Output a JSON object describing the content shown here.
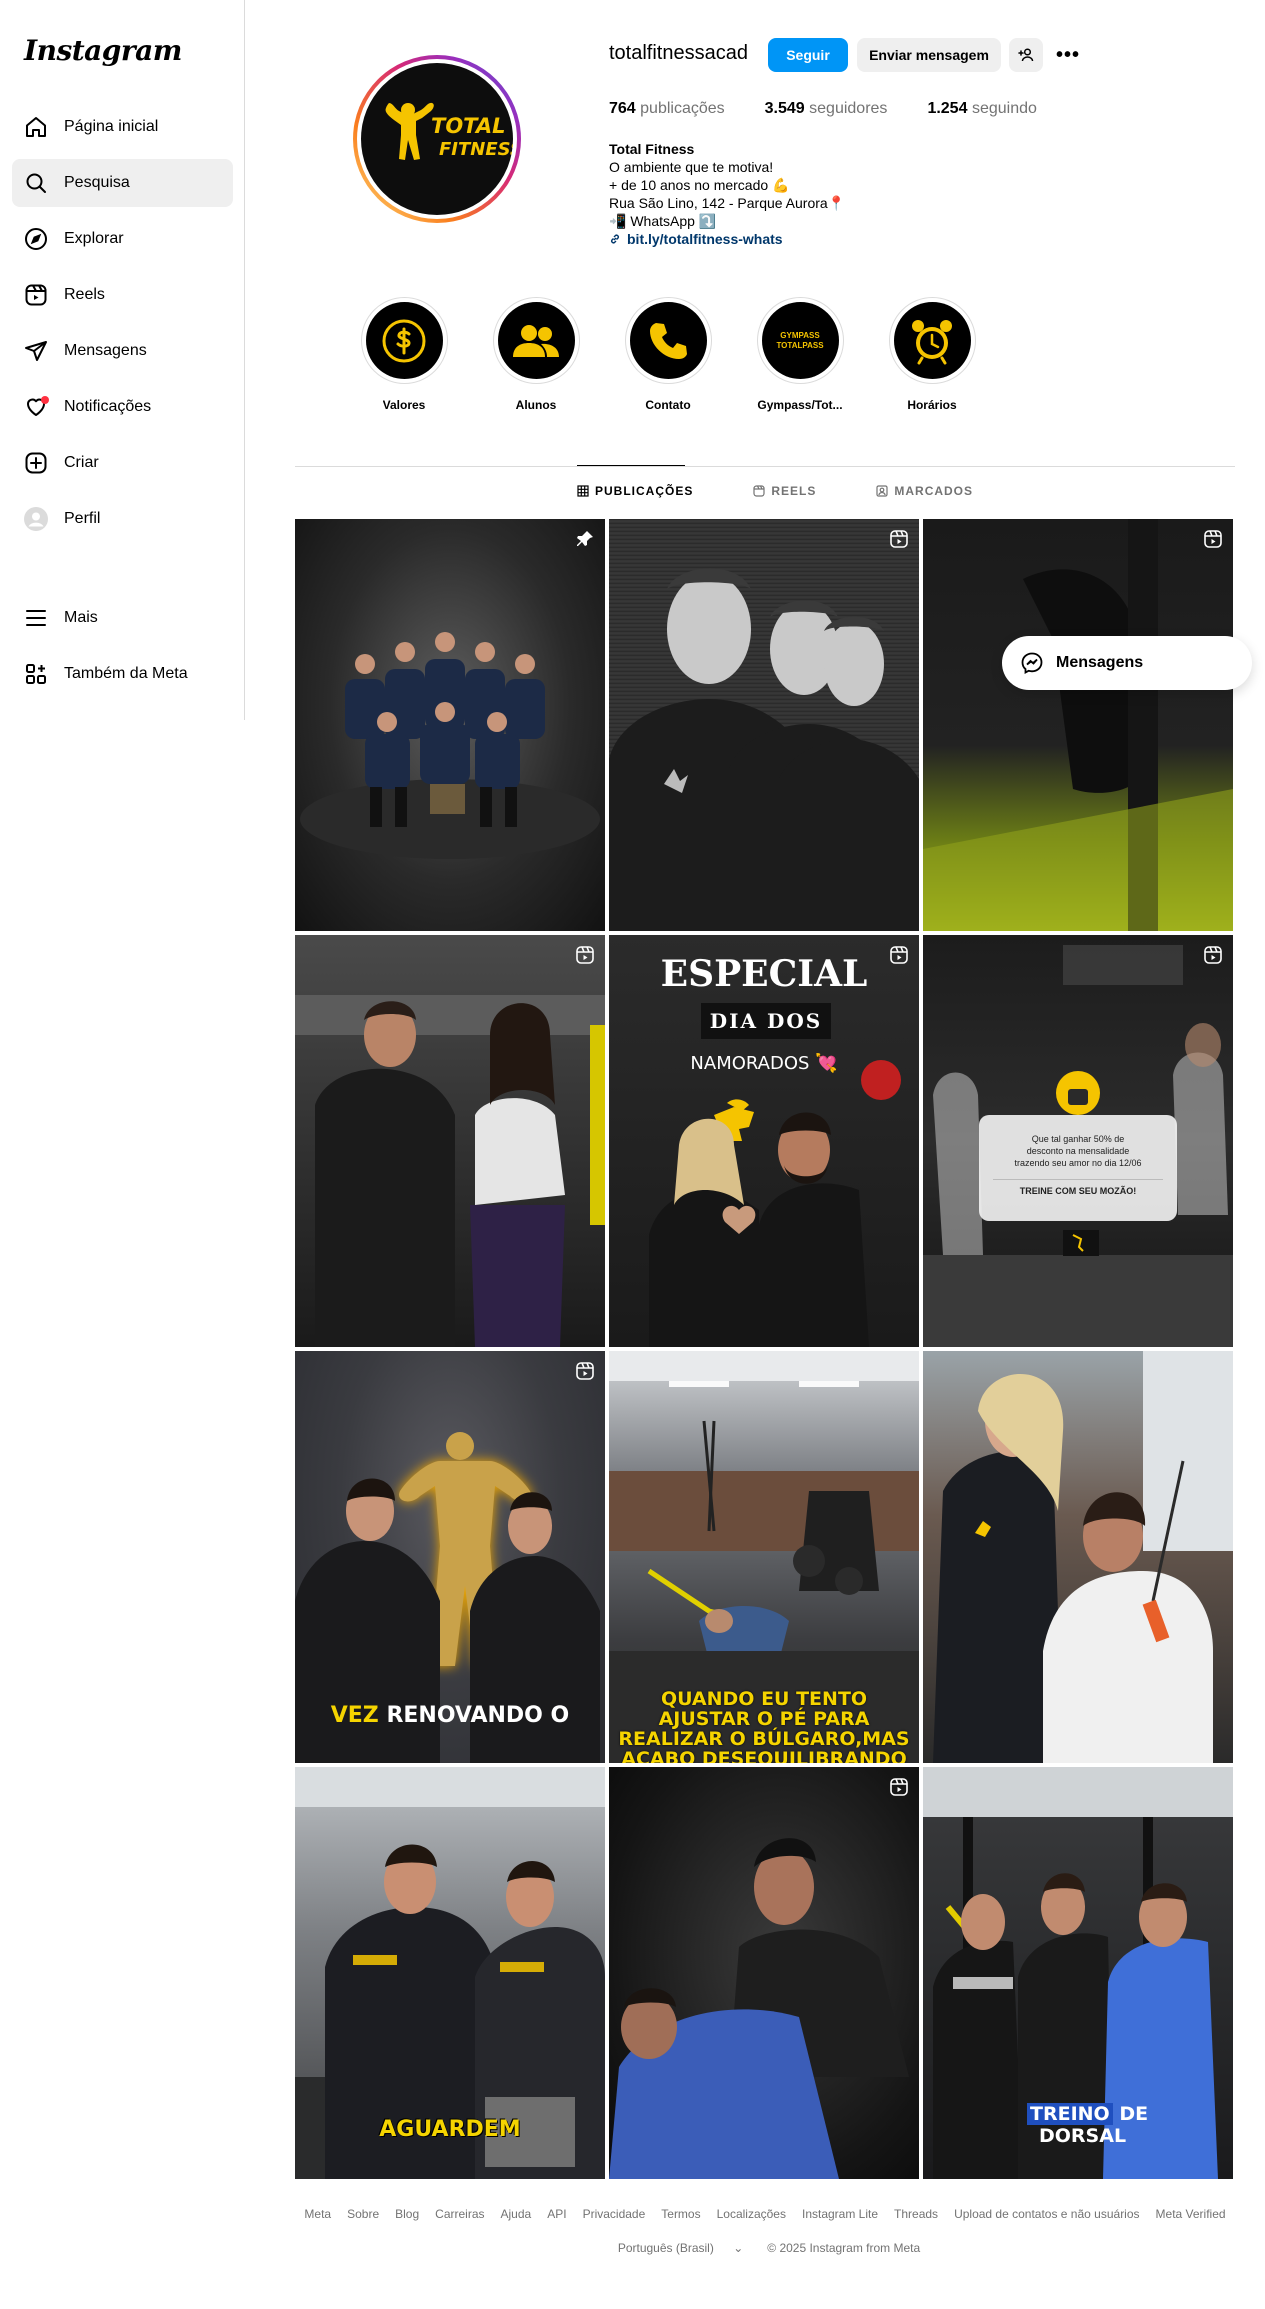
{
  "app": {
    "logo": "Instagram"
  },
  "sidebar": {
    "items": [
      {
        "label": "Página inicial",
        "icon": "home-icon"
      },
      {
        "label": "Pesquisa",
        "icon": "search-icon"
      },
      {
        "label": "Explorar",
        "icon": "compass-icon"
      },
      {
        "label": "Reels",
        "icon": "reels-icon"
      },
      {
        "label": "Mensagens",
        "icon": "send-icon"
      },
      {
        "label": "Notificações",
        "icon": "heart-icon"
      },
      {
        "label": "Criar",
        "icon": "plus-square-icon"
      },
      {
        "label": "Perfil",
        "icon": "profile-avatar-icon"
      }
    ],
    "bottom": [
      {
        "label": "Mais",
        "icon": "menu-icon"
      },
      {
        "label": "Também da Meta",
        "icon": "meta-apps-icon"
      }
    ]
  },
  "profile": {
    "username": "totalfitnessacad",
    "avatar_text_line1": "TOTAL",
    "avatar_text_line2": "FITNESS",
    "follow_label": "Seguir",
    "message_label": "Enviar mensagem",
    "more_label": "•••",
    "stats": {
      "posts_count": "764",
      "posts_label": "publicações",
      "followers_count": "3.549",
      "followers_label": "seguidores",
      "following_count": "1.254",
      "following_label": "seguindo"
    },
    "bio": {
      "name": "Total Fitness",
      "line1": "O ambiente que te motiva!",
      "line2": "+ de 10 anos no mercado 💪",
      "line3": "Rua São Lino, 142 - Parque Aurora📍",
      "line4": "📲 WhatsApp ⤵️",
      "link": "bit.ly/totalfitness-whats"
    }
  },
  "highlights": [
    {
      "label": "Valores",
      "icon": "dollar-coin-icon"
    },
    {
      "label": "Alunos",
      "icon": "people-icon"
    },
    {
      "label": "Contato",
      "icon": "phone-icon"
    },
    {
      "label": "Gympass/Tot...",
      "icon": "gympass-totalpass-icon",
      "inner_line1": "GYMPASS",
      "inner_line2": "TOTALPASS"
    },
    {
      "label": "Horários",
      "icon": "alarm-clock-icon"
    }
  ],
  "tabs": [
    {
      "label": "PUBLICAÇÕES",
      "icon": "grid-icon",
      "active": true
    },
    {
      "label": "REELS",
      "icon": "reels-icon",
      "active": false
    },
    {
      "label": "MARCADOS",
      "icon": "tagged-icon",
      "active": false
    }
  ],
  "posts": [
    {
      "badge": "pin-icon"
    },
    {
      "badge": "reel-icon"
    },
    {
      "badge": "reel-icon"
    },
    {
      "badge": "reel-icon"
    },
    {
      "badge": "reel-icon",
      "title": "ESPECIAL",
      "subtitle": "DIA DOS",
      "subtitle2": "NAMORADOS 💘"
    },
    {
      "badge": "reel-icon",
      "card_line1": "Que tal ganhar 50% de",
      "card_line2": "desconto na mensalidade",
      "card_line3": "trazendo seu amor no dia 12/06",
      "card_cta": "TREINE COM SEU MOZÃO!"
    },
    {
      "badge": "reel-icon",
      "caption_yellow": "VEZ",
      "caption_white": "RENOVANDO O"
    },
    {
      "badge": "reel-icon",
      "caption_line1": "QUANDO EU TENTO",
      "caption_line2": "AJUSTAR O PÉ PARA",
      "caption_line3": "REALIZAR O BÚLGARO,MAS",
      "caption_line4": "ACABO DESEQUILIBRANDO"
    },
    {
      "badge": "reel-icon"
    },
    {
      "badge": "reel-icon",
      "caption": "AGUARDEM"
    },
    {
      "badge": "reel-icon"
    },
    {
      "badge": "reel-icon",
      "caption_blue": "TREINO",
      "caption_white": "DE",
      "caption_line2": "DORSAL"
    }
  ],
  "floating_messages": {
    "label": "Mensagens"
  },
  "footer": {
    "links": [
      "Meta",
      "Sobre",
      "Blog",
      "Carreiras",
      "Ajuda",
      "API",
      "Privacidade",
      "Termos",
      "Localizações",
      "Instagram Lite",
      "Threads",
      "Upload de contatos e não usuários",
      "Meta Verified"
    ],
    "language": "Português (Brasil)",
    "copyright": "© 2025 Instagram from Meta"
  },
  "colors": {
    "accent": "#0095f6",
    "link": "#00376b",
    "brand_yellow": "#f5c400"
  }
}
